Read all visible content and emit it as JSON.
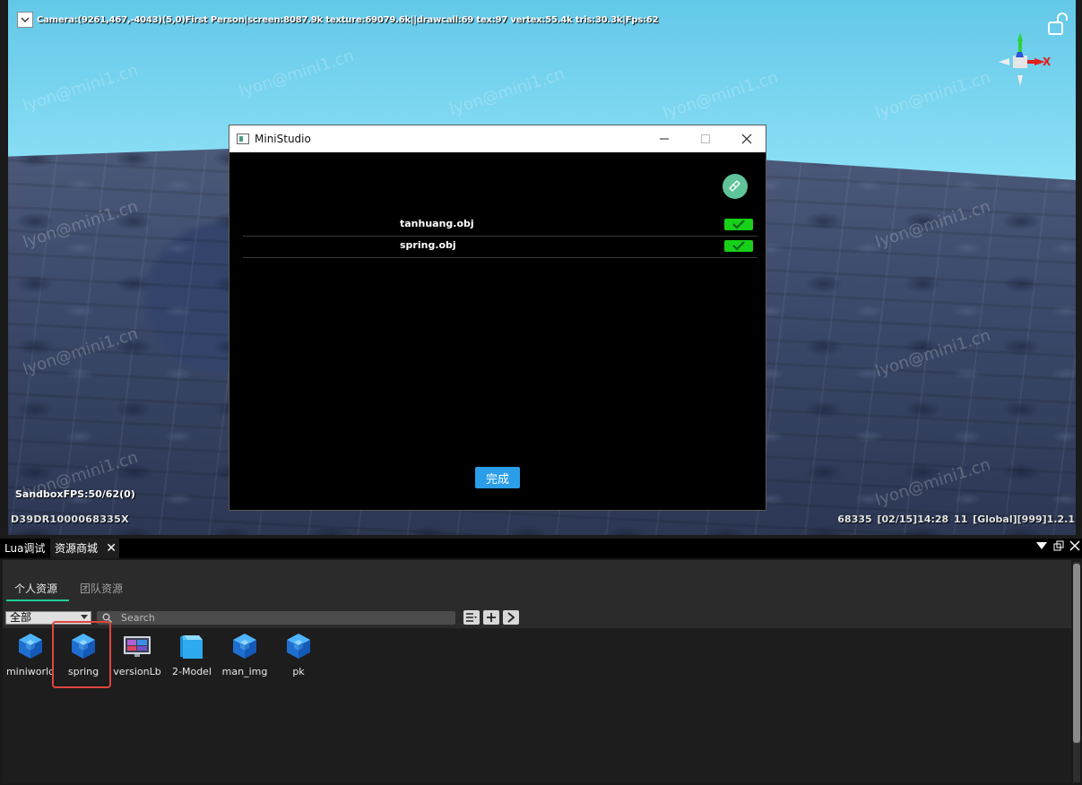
{
  "hud": {
    "stats": "Camera:(9261,467,-4043)(5,0)First Person|screen:8087.9k texture:69079.6k||drawcall:69 tex:97 vertex:55.4k tris:30.3k|Fps:62",
    "fps": "SandboxFPS:50/62(0)",
    "device_id": "D39DR1000068335X",
    "status_right": "68335   [02/15]14:28 11  [Global][999]1.2.1",
    "watermark": "lyon@mini1.cn",
    "gizmo_x": "X"
  },
  "window": {
    "title": "MiniStudio",
    "files": [
      {
        "name": "tanhuang.obj",
        "checked": true
      },
      {
        "name": "spring.obj",
        "checked": true
      }
    ],
    "done_label": "完成"
  },
  "panel": {
    "tabs": [
      "Lua调试",
      "资源商城"
    ],
    "subtabs": [
      "个人资源",
      "团队资源"
    ],
    "filter": "全部",
    "search_placeholder": "Search",
    "assets": [
      {
        "label": "miniworld",
        "icon": "cube-icon"
      },
      {
        "label": "spring",
        "icon": "cube-icon"
      },
      {
        "label": "versionLb",
        "icon": "screen-icon"
      },
      {
        "label": "2-Model",
        "icon": "light-cube-icon"
      },
      {
        "label": "man_img",
        "icon": "cube-icon"
      },
      {
        "label": "pk",
        "icon": "cube-icon"
      }
    ],
    "highlighted_asset": "spring"
  },
  "colors": {
    "accent_green": "#1fcf9a",
    "check_green": "#18d018",
    "done_blue": "#2a9ee8",
    "highlight_red": "#e0453c"
  }
}
